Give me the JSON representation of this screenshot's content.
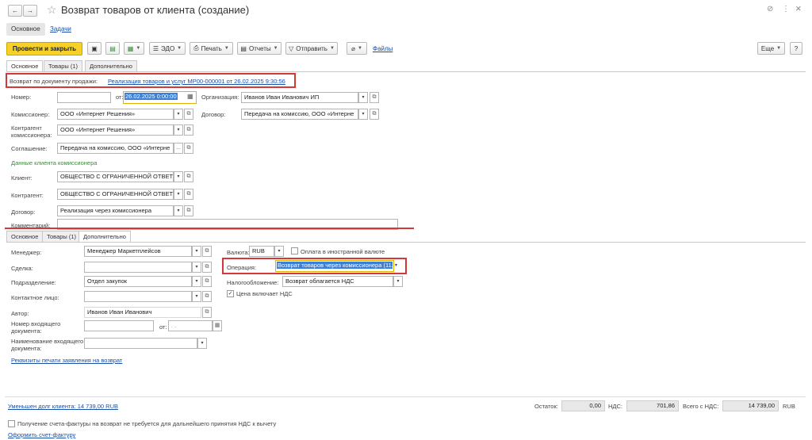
{
  "window": {
    "title": "Возврат товаров от клиента (создание)",
    "back_icon": "←",
    "forward_icon": "→",
    "star_icon": "☆",
    "link_icon": "⊘",
    "more_icon": "⋮",
    "close_icon": "×"
  },
  "top_tabs": [
    "Основное",
    "Задачи"
  ],
  "toolbar": {
    "post_close": "Провести и закрыть",
    "edo": "ЭДО",
    "print": "Печать",
    "reports": "Отчеты",
    "send": "Отправить",
    "files": "Файлы",
    "more": "Еще",
    "help": "?"
  },
  "form_tabs": [
    "Основное",
    "Товары (1)",
    "Дополнительно"
  ],
  "return_doc": {
    "label": "Возврат по документу продажи:",
    "link": "Реализация товаров и услуг МР00-000001 от 26.02.2025 9:30:56"
  },
  "fields": {
    "number_label": "Номер:",
    "number_value": "",
    "from_label": "от:",
    "date_value": "26.02.2025  0:00:00",
    "org_label": "Организация:",
    "org_value": "Иванов Иван Иванович ИП",
    "commissioner_label": "Комиссионер:",
    "commissioner_value": "ООО «Интернет Решения»",
    "contract_label": "Договор:",
    "contract_value": "Передача на комиссию, ООО «Интерне",
    "counterparty_label1": "Контрагент",
    "counterparty_label2": "комиссионера:",
    "counterparty_value": "ООО «Интернет Решения»",
    "agreement_label": "Соглашение:",
    "agreement_value": "Передача на комиссию, ООО «Интерне",
    "client_section": "Данные клиента комиссионера",
    "client_label": "Клиент:",
    "client_value": "ОБЩЕСТВО С ОГРАНИЧЕННОЙ ОТВЕТ",
    "kontragent_label": "Контрагент:",
    "kontragent_value": "ОБЩЕСТВО С ОГРАНИЧЕННОЙ ОТВЕТ",
    "dogovor_label": "Договор:",
    "dogovor_value": "Реализация через комиссионера",
    "comment_label": "Комментарий:",
    "comment_value": ""
  },
  "extra": {
    "manager_label": "Менеджер:",
    "manager_value": "Менеджер Маркетплейсов",
    "deal_label": "Сделка:",
    "deal_value": "",
    "department_label": "Подразделение:",
    "department_value": "Отдел закупок",
    "contact_label": "Контактное лицо:",
    "contact_value": "",
    "author_label": "Автор:",
    "author_value": "Иванов Иван Иванович",
    "incoming_num_label1": "Номер входящего",
    "incoming_num_label2": "документа:",
    "incoming_num_value": "",
    "incoming_from_label": "от:",
    "incoming_date_value": " .  .",
    "incoming_name_label1": "Наименование входящего",
    "incoming_name_label2": "документа:",
    "incoming_name_value": "",
    "print_link": "Реквизиты печати заявления на возврат",
    "currency_label": "Валюта:",
    "currency_value": "RUB",
    "foreign_currency_label": "Оплата в иностранной валюте",
    "operation_label": "Операция:",
    "operation_value": "Возврат товаров через комиссионера (11.6",
    "taxation_label": "Налогообложение:",
    "taxation_value": "Возврат облагается НДС",
    "price_includes_vat_label": "Цена включает НДС",
    "price_includes_vat_mark": "✓"
  },
  "footer": {
    "debt_link": "Уменьшен долг клиента: 14 739,00 RUB",
    "remainder_label": "Остаток:",
    "remainder_value": "0,00",
    "vat_label": "НДС:",
    "vat_value": "701,86",
    "total_label": "Всего с НДС:",
    "total_value": "14 739,00",
    "currency": "RUB",
    "invoice_checkbox_label": "Получение счета-фактуры на возврат не требуется для дальнейшего принятия НДС к вычету",
    "invoice_link": "Оформить счет-фактуру"
  },
  "colors": {
    "accent_yellow": "#f6d12a",
    "highlight_red": "#d23a3a",
    "link_blue": "#1a4fa8",
    "section_green": "#3a8a3a",
    "selection_blue": "#3b7fd6"
  }
}
